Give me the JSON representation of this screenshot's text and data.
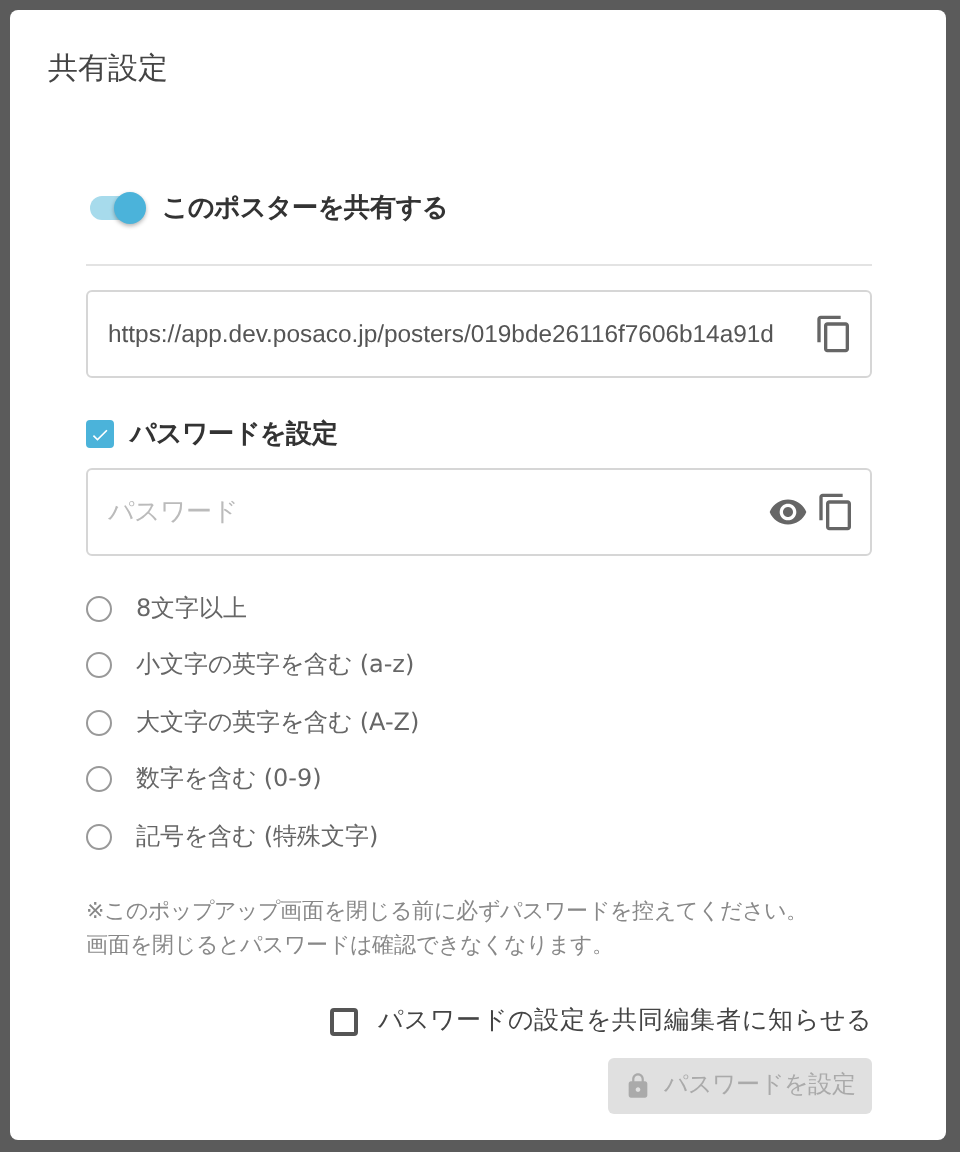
{
  "dialog": {
    "title": "共有設定"
  },
  "share_toggle": {
    "label": "このポスターを共有する",
    "on": true
  },
  "share_url": {
    "value": "https://app.dev.posaco.jp/posters/019bde26116f7606b14a91d"
  },
  "password_toggle": {
    "label": "パスワードを設定",
    "checked": true
  },
  "password_field": {
    "placeholder": "パスワード"
  },
  "requirements": [
    {
      "label": "8文字以上",
      "met": false
    },
    {
      "label": "小文字の英字を含む (a-z)",
      "met": false
    },
    {
      "label": "大文字の英字を含む (A-Z)",
      "met": false
    },
    {
      "label": "数字を含む (0-9)",
      "met": false
    },
    {
      "label": "記号を含む (特殊文字)",
      "met": false
    }
  ],
  "note": [
    "※このポップアップ画面を閉じる前に必ずパスワードを控えてください。",
    "画面を閉じるとパスワードは確認できなくなります。"
  ],
  "notify": {
    "label": "パスワードの設定を共同編集者に知らせる",
    "checked": false
  },
  "submit_button": {
    "label": "パスワードを設定",
    "disabled": true
  }
}
